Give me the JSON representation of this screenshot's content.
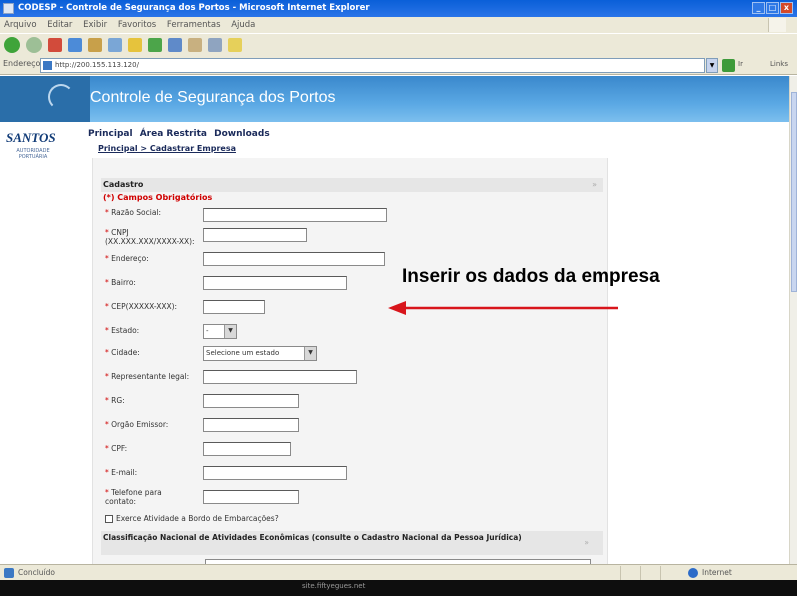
{
  "window": {
    "title": "CODESP - Controle de Segurança dos Portos - Microsoft Internet Explorer",
    "controls": [
      "_",
      "□",
      "x"
    ]
  },
  "menubar": {
    "items": [
      "Arquivo",
      "Editar",
      "Exibir",
      "Favoritos",
      "Ferramentas",
      "Ajuda"
    ]
  },
  "addressbar": {
    "label": "Endereço",
    "url": "http://200.155.113.120/",
    "go_label": "Ir",
    "links_label": "Links"
  },
  "site": {
    "title": "Controle de Segurança dos Portos",
    "logo_text": "SANTOS",
    "logo_subtext": "AUTORIDADE PORTUÁRIA"
  },
  "nav": {
    "items": [
      "Principal",
      "Área Restrita",
      "Downloads"
    ]
  },
  "breadcrumb": "Principal > Cadastrar Empresa",
  "form": {
    "section_title": "Cadastro",
    "collapse_symbol": "»",
    "required_note": "(*) Campos Obrigatórios",
    "fields": [
      {
        "label": "Razão Social:",
        "required": true
      },
      {
        "label": "CNPJ (XX.XXX.XXX/XXXX-XX):",
        "required": true
      },
      {
        "label": "Endereço:",
        "required": true
      },
      {
        "label": "Bairro:",
        "required": true
      },
      {
        "label": "CEP(XXXXX-XXX):",
        "required": true
      },
      {
        "label": "Estado:",
        "required": true,
        "type": "select",
        "value": "-"
      },
      {
        "label": "Cidade:",
        "required": true,
        "type": "select",
        "value": "Selecione um estado"
      },
      {
        "label": "Representante legal:",
        "required": true
      },
      {
        "label": "RG:",
        "required": true
      },
      {
        "label": "Orgão Emissor:",
        "required": true
      },
      {
        "label": "CPF:",
        "required": true
      },
      {
        "label": "E-mail:",
        "required": true
      },
      {
        "label": "Telefone para contato:",
        "required": true
      }
    ],
    "checkbox_label": "Exerce Atividade a Bordo de Embarcações?",
    "classification_title": "Classificação Nacional de Atividades Econômicas (consulte o Cadastro Nacional da Pessoa Jurídica)"
  },
  "annotation": {
    "text": "Inserir os dados da empresa",
    "arrow_color": "#d8151b"
  },
  "statusbar": {
    "status": "Concluído",
    "zone": "Internet"
  },
  "taskbar": {
    "text": "site.fiftyegues.net"
  },
  "colors": {
    "header_blue": "#3a88cc",
    "required_red": "#d00000",
    "nav_text": "#1a2a5a"
  }
}
